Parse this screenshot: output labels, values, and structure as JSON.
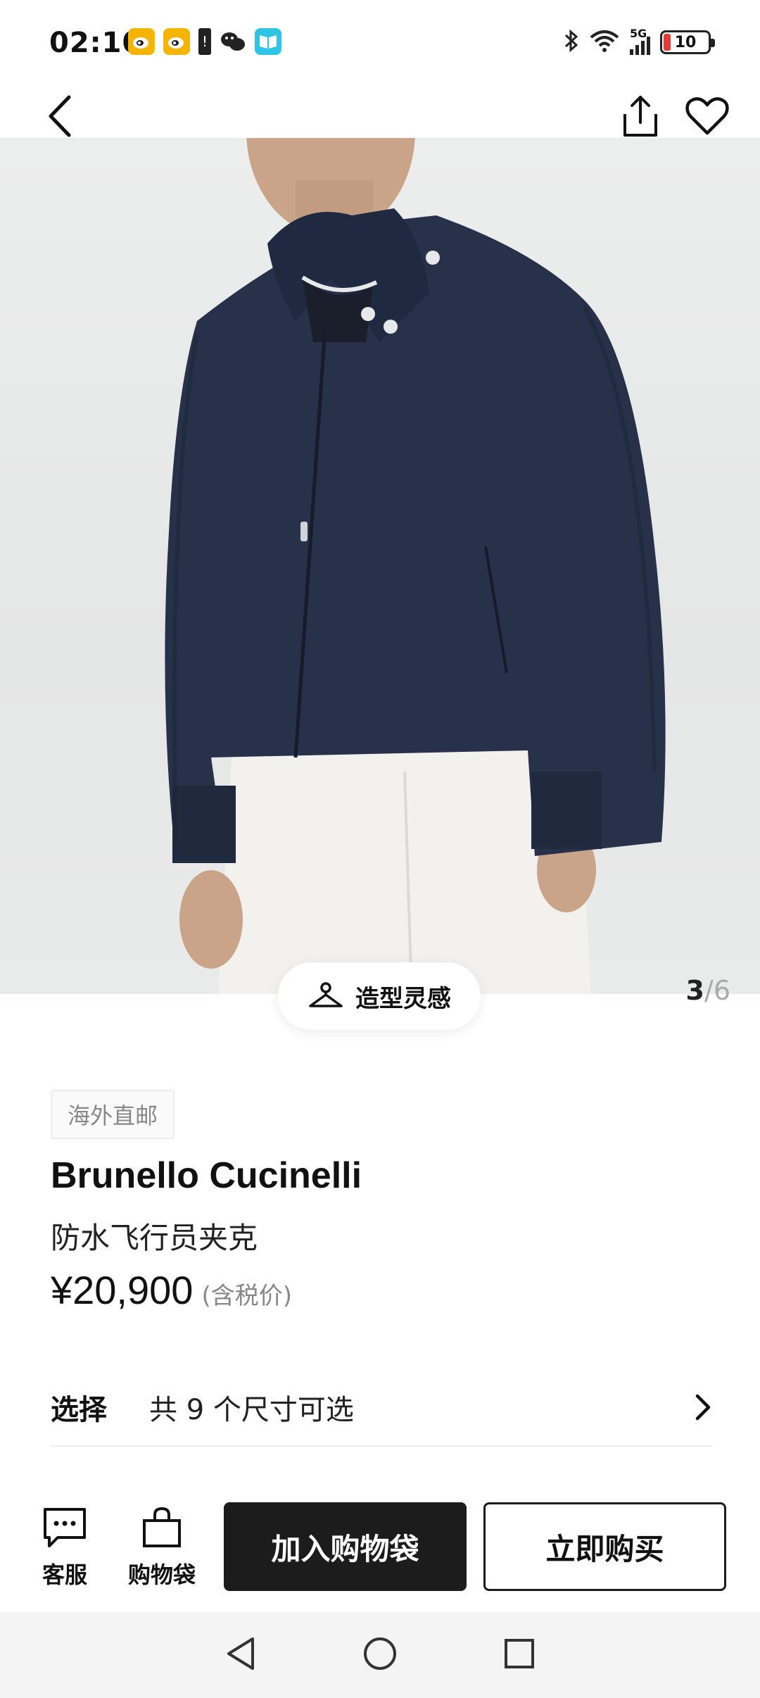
{
  "status_bar": {
    "time": "02:10",
    "network": "5G",
    "battery": "10"
  },
  "nav": {
    "back_icon": "chevron-left-icon",
    "share_icon": "share-icon",
    "favorite_icon": "heart-icon"
  },
  "gallery": {
    "current": "3",
    "separator": "/",
    "total": "6",
    "style_button_label": "造型灵感"
  },
  "product": {
    "tag": "海外直邮",
    "brand": "Brunello Cucinelli",
    "name": "防水飞行员夹克",
    "price": "¥20,900",
    "tax_note": "(含税价)"
  },
  "selection": {
    "label": "选择",
    "value": "共 9 个尺寸可选"
  },
  "actions": {
    "service_label": "客服",
    "bag_label": "购物袋",
    "add_to_bag_label": "加入购物袋",
    "buy_now_label": "立即购买"
  },
  "colors": {
    "jacket_navy": "#27324a",
    "button_dark": "#1c1c1c",
    "muted_text": "#888888"
  }
}
